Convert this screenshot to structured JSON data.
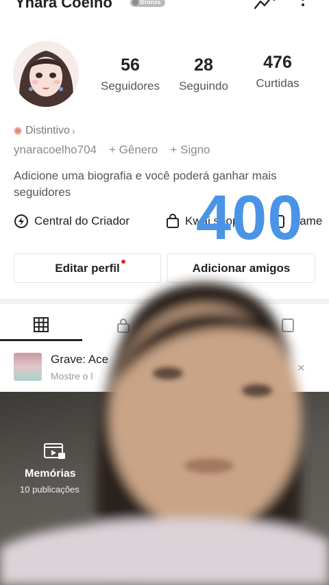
{
  "header": {
    "username": "Ynara Coelho",
    "badge_label": "Bronze"
  },
  "icons": {
    "trend": "trend-chart-icon",
    "more": "more-vertical-icon",
    "flash": "lightning-icon",
    "shop": "shopping-bag-icon",
    "game": "game-icon",
    "grid": "grid-icon",
    "lock": "lock-icon",
    "liked": "liked-posts-icon",
    "close": "close-icon",
    "memories": "memories-film-icon"
  },
  "stats": {
    "followers_count": "56",
    "followers_label": "Seguidores",
    "following_count": "28",
    "following_label": "Seguindo",
    "likes_count": "476",
    "likes_label": "Curtidas"
  },
  "profile": {
    "distintivo_label": "Distintivo",
    "distintivo_chevron": "›",
    "handle": "ynaracoelho704",
    "gender_link": "+ Gênero",
    "sign_link": "+ Signo",
    "bio_placeholder": "Adicione uma biografia e você poderá ganhar mais seguidores"
  },
  "overlay_text": "400",
  "creator_row": {
    "central": "Central do Criador",
    "shop": "Kwai shop",
    "game": "Game"
  },
  "buttons": {
    "edit_profile": "Editar perfil",
    "add_friends": "Adicionar amigos"
  },
  "banner": {
    "title": "Grave: Ace",
    "subtitle": "Mostre o l",
    "close": "×"
  },
  "memorias": {
    "title": "Memórias",
    "count": "10 publicações"
  },
  "colors": {
    "accent_blue": "#4a94e6",
    "notification_red": "#e9242e",
    "badge_gray": "#b9b9b9"
  }
}
